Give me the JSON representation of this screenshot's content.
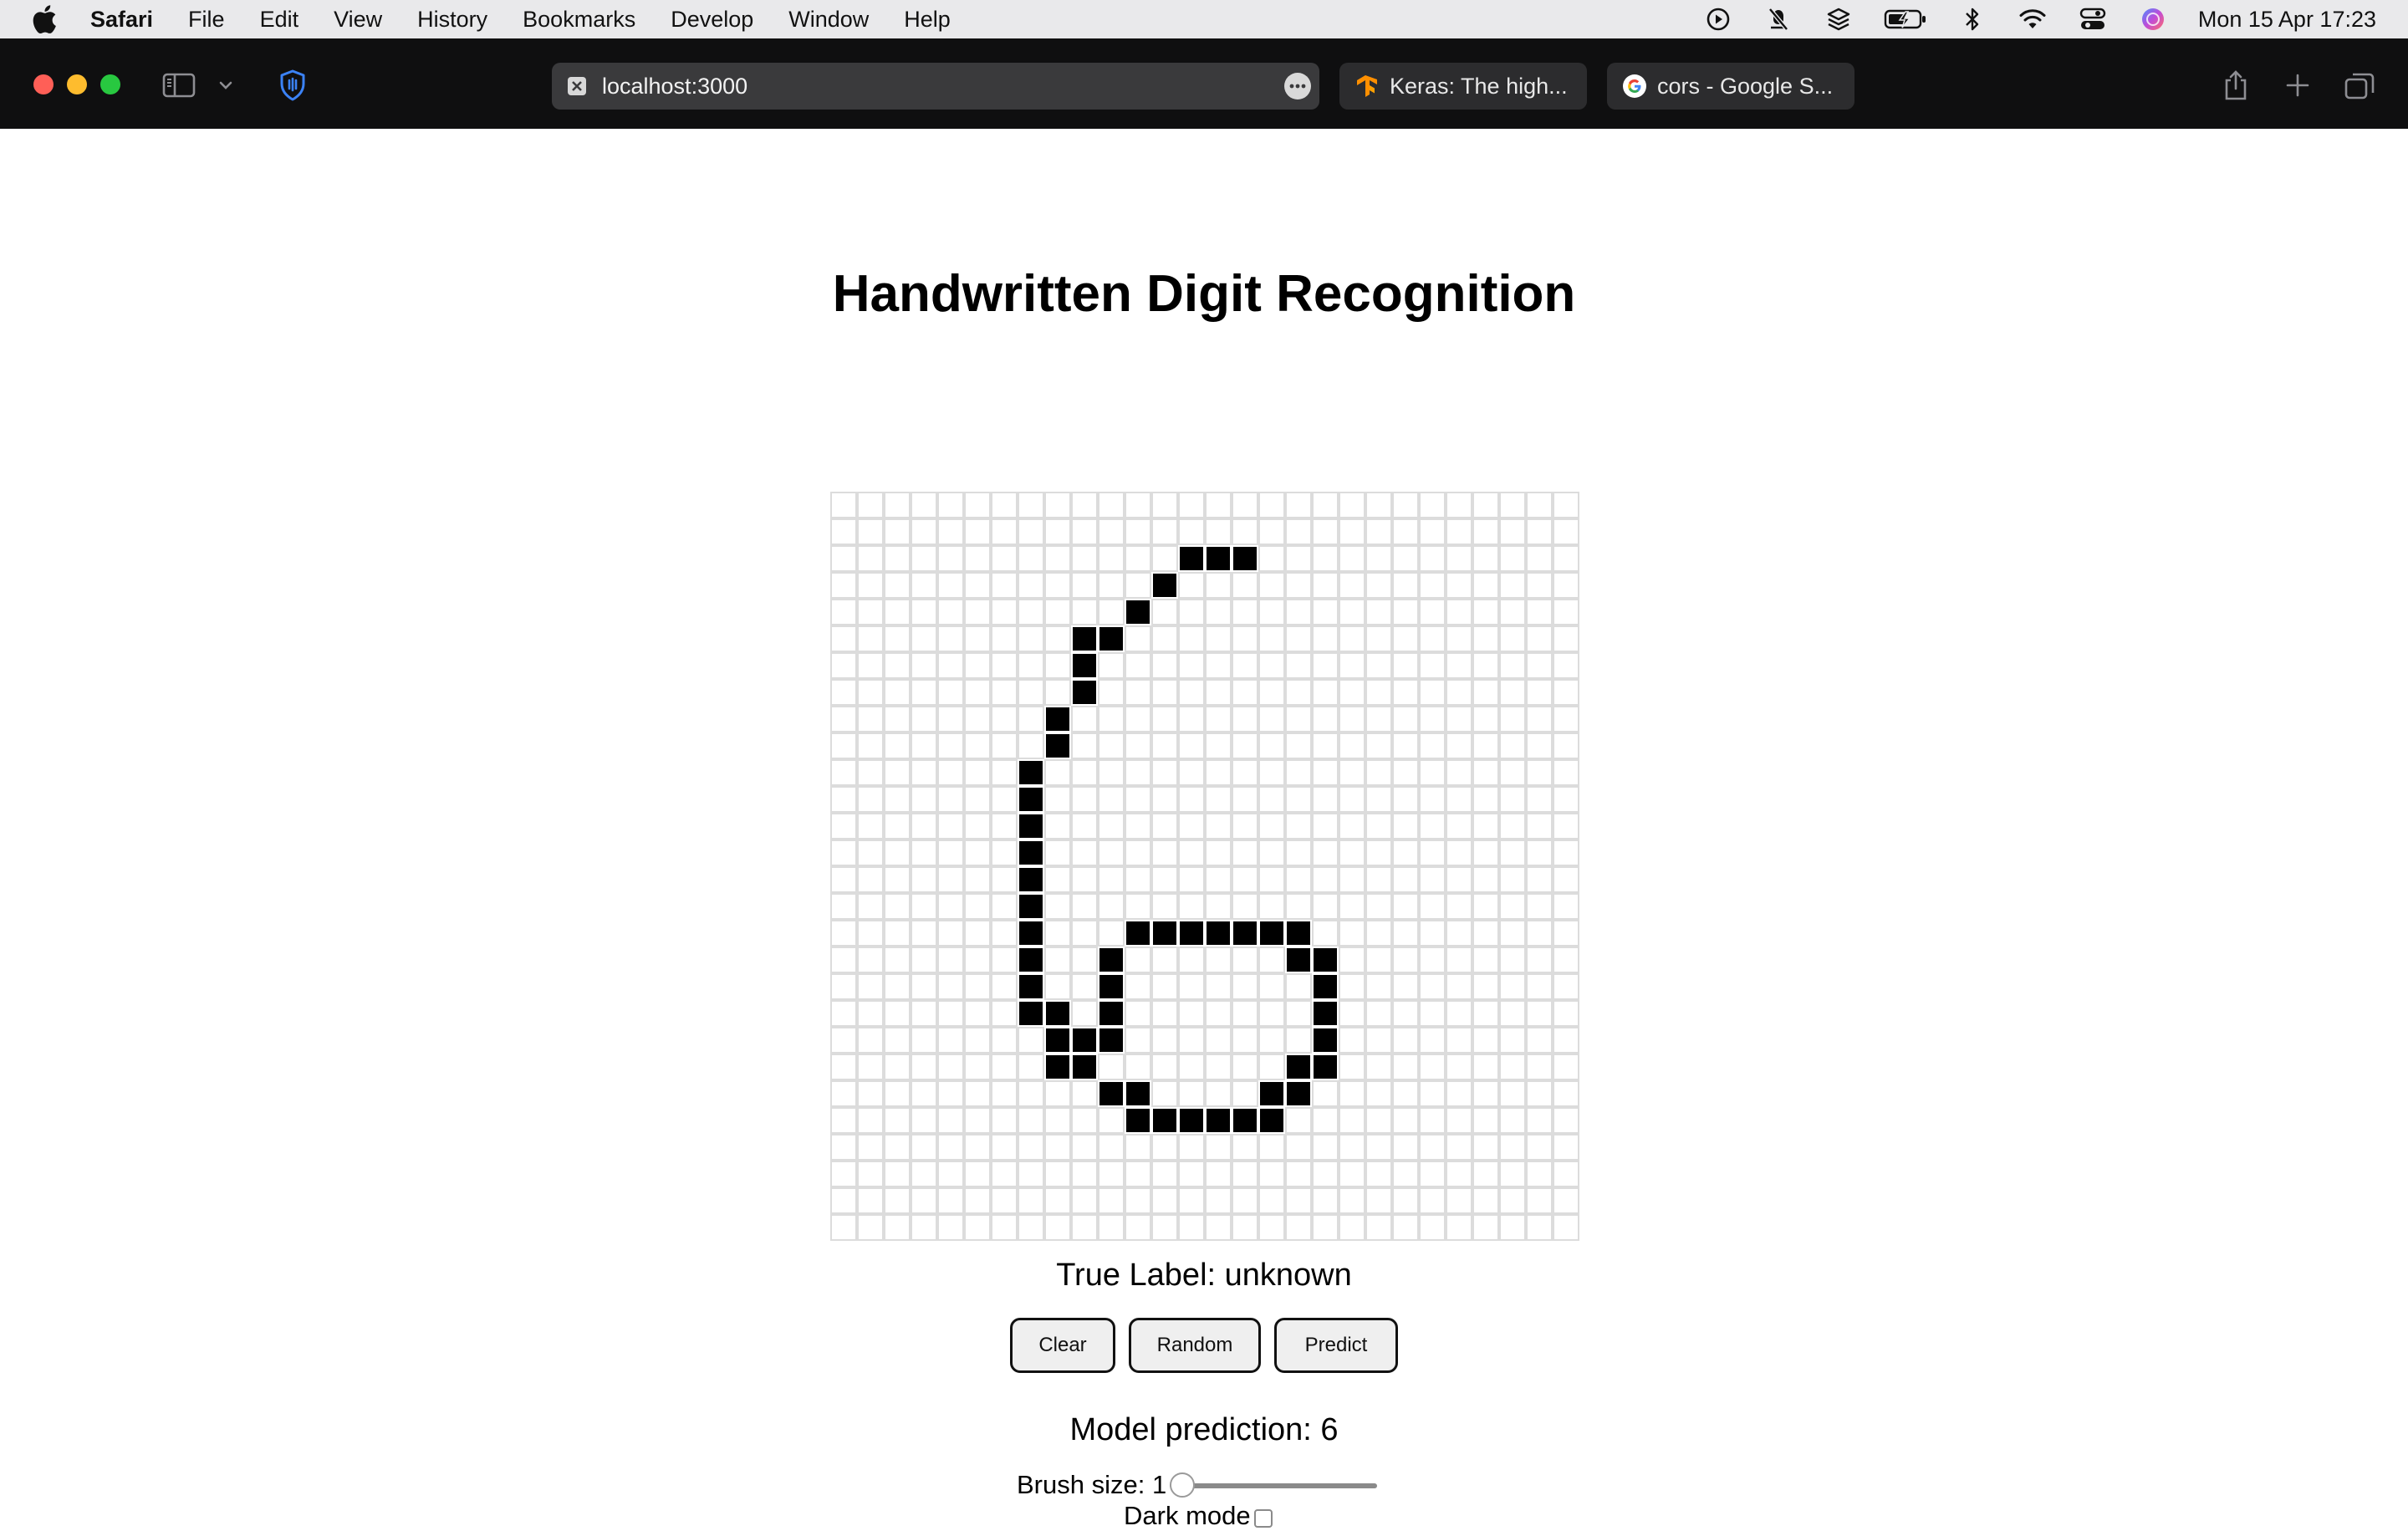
{
  "menubar": {
    "app_name": "Safari",
    "items": [
      "File",
      "Edit",
      "View",
      "History",
      "Bookmarks",
      "Develop",
      "Window",
      "Help"
    ],
    "status_icons": [
      "play-circle-icon",
      "mic-muted-icon",
      "layers-icon",
      "battery-charging-icon",
      "bluetooth-icon",
      "wifi-icon",
      "control-center-icon",
      "siri-icon"
    ],
    "clock": "Mon 15 Apr  17:23"
  },
  "browser": {
    "url": "localhost:3000",
    "tabs": [
      {
        "title": "Keras: The high...",
        "icon": "tensorflow-icon"
      },
      {
        "title": "cors - Google S...",
        "icon": "google-icon"
      }
    ],
    "traffic_light_colors": {
      "close": "#ff5f57",
      "minimize": "#febc2e",
      "maximize": "#28c840"
    }
  },
  "page": {
    "title": "Handwritten Digit Recognition",
    "true_label": "True Label: unknown",
    "buttons": {
      "clear": "Clear",
      "random": "Random",
      "predict": "Predict"
    },
    "prediction": "Model prediction: 6",
    "brush_label": "Brush size: 1",
    "brush_value": 1,
    "dark_mode_label": "Dark mode",
    "dark_mode_checked": false
  },
  "canvas": {
    "rows": 28,
    "cols": 28,
    "filled_cells": [
      [
        2,
        13
      ],
      [
        2,
        14
      ],
      [
        2,
        15
      ],
      [
        3,
        12
      ],
      [
        4,
        11
      ],
      [
        5,
        9
      ],
      [
        5,
        10
      ],
      [
        6,
        9
      ],
      [
        7,
        9
      ],
      [
        8,
        8
      ],
      [
        9,
        8
      ],
      [
        10,
        7
      ],
      [
        11,
        7
      ],
      [
        12,
        7
      ],
      [
        13,
        7
      ],
      [
        14,
        7
      ],
      [
        15,
        7
      ],
      [
        16,
        7
      ],
      [
        16,
        11
      ],
      [
        16,
        12
      ],
      [
        16,
        13
      ],
      [
        16,
        14
      ],
      [
        16,
        15
      ],
      [
        16,
        16
      ],
      [
        16,
        17
      ],
      [
        17,
        7
      ],
      [
        17,
        10
      ],
      [
        17,
        17
      ],
      [
        17,
        18
      ],
      [
        18,
        7
      ],
      [
        18,
        10
      ],
      [
        18,
        18
      ],
      [
        19,
        7
      ],
      [
        19,
        8
      ],
      [
        19,
        10
      ],
      [
        19,
        18
      ],
      [
        20,
        8
      ],
      [
        20,
        9
      ],
      [
        20,
        10
      ],
      [
        20,
        18
      ],
      [
        21,
        8
      ],
      [
        21,
        9
      ],
      [
        21,
        17
      ],
      [
        21,
        18
      ],
      [
        22,
        10
      ],
      [
        22,
        11
      ],
      [
        22,
        16
      ],
      [
        22,
        17
      ],
      [
        23,
        11
      ],
      [
        23,
        12
      ],
      [
        23,
        13
      ],
      [
        23,
        14
      ],
      [
        23,
        15
      ],
      [
        23,
        16
      ]
    ]
  }
}
